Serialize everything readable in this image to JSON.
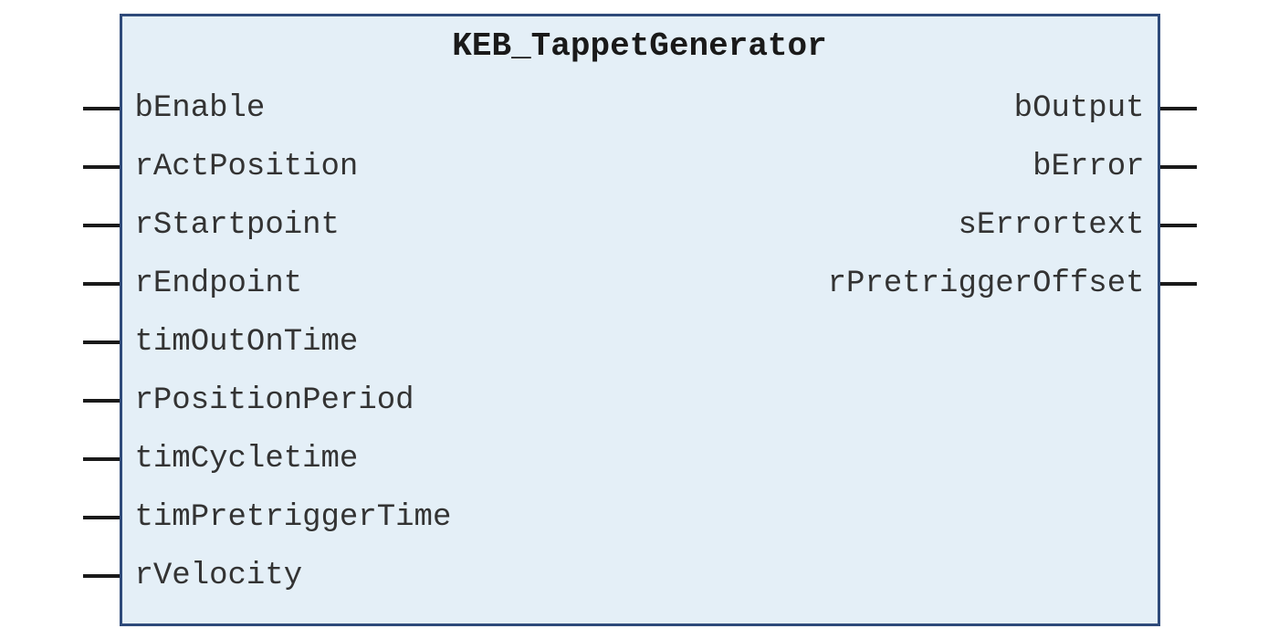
{
  "block": {
    "title": "KEB_TappetGenerator",
    "inputs": [
      "bEnable",
      "rActPosition",
      "rStartpoint",
      "rEndpoint",
      "timOutOnTime",
      "rPositionPeriod",
      "timCycletime",
      "timPretriggerTime",
      "rVelocity"
    ],
    "outputs": [
      "bOutput",
      "bError",
      "sErrortext",
      "rPretriggerOffset"
    ]
  }
}
